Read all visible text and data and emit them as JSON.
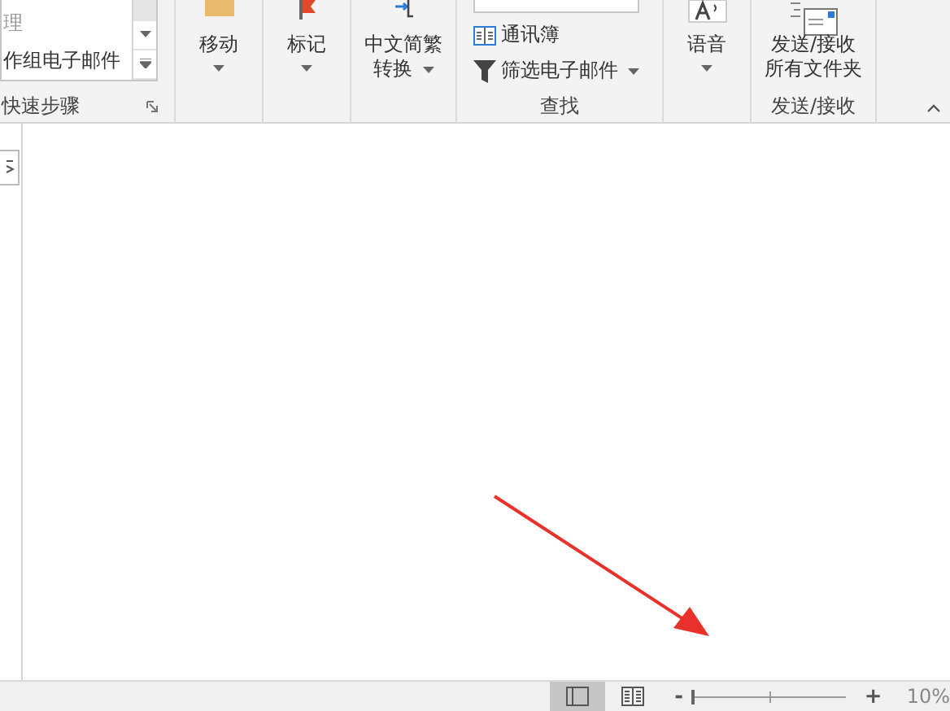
{
  "ribbon": {
    "groups": [
      {
        "kind": "gallery",
        "items": [
          {
            "label": "理",
            "disabled": true
          },
          {
            "label": "作组电子邮件",
            "disabled": false
          }
        ],
        "label": "快速步骤",
        "launcher": true
      },
      {
        "kind": "large",
        "buttons": [
          {
            "kind": "move",
            "lines": [
              "移动"
            ],
            "dropdown": true
          }
        ]
      },
      {
        "kind": "large",
        "buttons": [
          {
            "kind": "flag",
            "lines": [
              "标记"
            ],
            "dropdown": true
          }
        ]
      },
      {
        "kind": "large",
        "buttons": [
          {
            "kind": "convert",
            "lines": [
              "中文简繁",
              "转换"
            ],
            "dropdown": true
          }
        ]
      },
      {
        "kind": "small",
        "items": [
          {
            "kind": "book",
            "label": "通讯簿",
            "dropdown": false
          },
          {
            "kind": "filter",
            "label": "筛选电子邮件",
            "dropdown": true
          }
        ],
        "label": "查找"
      },
      {
        "kind": "large",
        "buttons": [
          {
            "kind": "speech",
            "lines": [
              "语音"
            ],
            "dropdown": true
          }
        ]
      },
      {
        "kind": "large",
        "buttons": [
          {
            "kind": "sendreceive",
            "lines": [
              "发送/接收",
              "所有文件夹"
            ],
            "dropdown": false
          }
        ],
        "label": "发送/接收"
      }
    ]
  },
  "status_bar": {
    "views": [
      {
        "kind": "normal",
        "selected": true
      },
      {
        "kind": "reading",
        "selected": false
      }
    ],
    "zoom": {
      "minus": "-",
      "plus": "+",
      "level": 0.0,
      "reading": "10%"
    }
  }
}
